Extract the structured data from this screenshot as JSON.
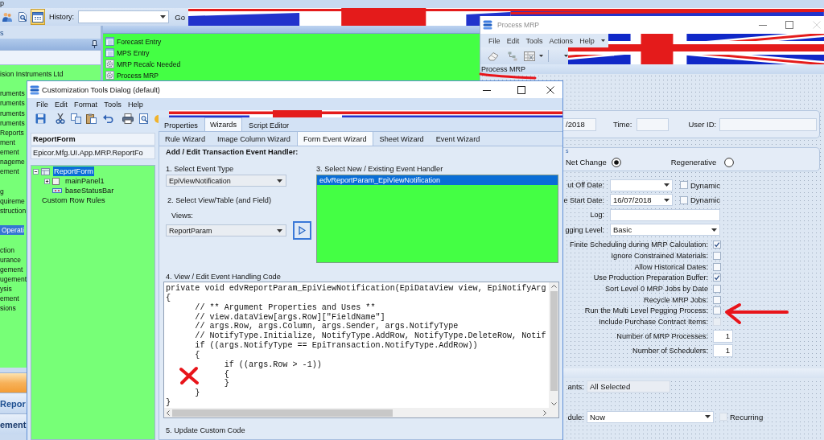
{
  "main_window": {
    "title": "p",
    "toolbar": {
      "buttons": [
        {
          "kind": "people",
          "pressed": false
        },
        {
          "kind": "search",
          "pressed": false
        },
        {
          "kind": "calendar",
          "pressed": true
        }
      ],
      "history_label": "History:",
      "go_label": "Go"
    },
    "nav_panel": {
      "caption": "s",
      "groups": [
        {
          "items": [
            {
              "label": "ision Instruments Ltd",
              "selected": false
            }
          ]
        },
        {
          "items": [
            {
              "label": "ruments",
              "selected": false
            },
            {
              "label": "ruments",
              "selected": false
            },
            {
              "label": "ruments",
              "selected": false
            },
            {
              "label": "ruments",
              "selected": false
            },
            {
              "label": "Reports",
              "selected": false
            },
            {
              "label": "ment",
              "selected": false
            },
            {
              "label": "ement",
              "selected": false
            },
            {
              "label": "nageme",
              "selected": false
            },
            {
              "label": "ement",
              "selected": false
            }
          ]
        },
        {
          "items": [
            {
              "label": "g",
              "selected": false
            },
            {
              "label": "quireme",
              "selected": false
            },
            {
              "label": "struction",
              "selected": false
            }
          ]
        },
        {
          "items": [
            {
              "label": "Operati",
              "selected": true
            }
          ]
        },
        {
          "items": [
            {
              "label": "ction",
              "selected": false
            },
            {
              "label": "urance",
              "selected": false
            },
            {
              "label": "gement",
              "selected": false
            },
            {
              "label": "ugement",
              "selected": false
            },
            {
              "label": "ysis",
              "selected": false
            },
            {
              "label": "ement",
              "selected": false
            },
            {
              "label": "sions",
              "selected": false
            }
          ]
        }
      ],
      "buttons": [
        "Repor",
        "ement"
      ]
    },
    "menu_list": [
      {
        "label": "Forecast Entry",
        "kind": "form"
      },
      {
        "label": "MPS Entry",
        "kind": "form"
      },
      {
        "label": "MRP Recalc Needed",
        "kind": "process"
      },
      {
        "label": "Process MRP",
        "kind": "process"
      }
    ]
  },
  "process_mrp": {
    "title": "Process MRP",
    "menu": [
      "File",
      "Edit",
      "Tools",
      "Actions",
      "Help"
    ],
    "form_title": "Process MRP",
    "run_info": {
      "date_value": "/2018",
      "time_label": "Time:",
      "user_label": "User ID:"
    },
    "run_type": {
      "caption": "s",
      "options": [
        {
          "label": "Net Change",
          "selected": true
        },
        {
          "label": "Regenerative",
          "selected": false
        }
      ]
    },
    "date_rows": [
      {
        "kind": "date",
        "label": "ut Off Date:",
        "dynamic_label": "Dynamic",
        "dynamic_checked": false
      },
      {
        "kind": "date",
        "label": "e Start Date:",
        "value": "16/07/2018",
        "dynamic_label": "Dynamic",
        "dynamic_checked": false
      },
      {
        "kind": "text",
        "label": "Log:"
      },
      {
        "kind": "combo",
        "label": "gging Level:",
        "value": "Basic"
      }
    ],
    "flags": [
      {
        "label": "Finite Scheduling during MRP Calculation:",
        "checked": true,
        "disabled": false
      },
      {
        "label": "Ignore Constrained Materials:",
        "checked": false,
        "disabled": false
      },
      {
        "label": "Allow Historical Dates:",
        "checked": false,
        "disabled": false
      },
      {
        "label": "Use Production Preparation Buffer:",
        "checked": true,
        "disabled": false
      },
      {
        "label": "Sort Level 0 MRP Jobs by Date",
        "checked": false,
        "disabled": false
      },
      {
        "label": "Recycle MRP Jobs:",
        "checked": false,
        "disabled": false
      },
      {
        "label": "Run the Multi Level Pegging Process:",
        "checked": false,
        "disabled": false
      },
      {
        "label": "Include Purchase Contract Items:",
        "checked": false,
        "disabled": true
      }
    ],
    "counts": [
      {
        "label": "Number of MRP Processes:",
        "value": "1"
      },
      {
        "label": "Number of Schedulers:",
        "value": "1"
      }
    ],
    "plants": {
      "label": "ants:",
      "value": "All Selected"
    },
    "schedule": {
      "label": "dule:",
      "value": "Now",
      "recurring_label": "Recurring",
      "recurring_checked": false,
      "recurring_disabled": true
    }
  },
  "customization_dialog": {
    "title": "Customization Tools Dialog (default)",
    "menu": [
      "File",
      "Edit",
      "Format",
      "Tools",
      "Help"
    ],
    "form_name": "ReportForm",
    "class_name": "Epicor.Mfg.UI.App.MRP.ReportFo",
    "tree": [
      {
        "label": "ReportForm",
        "kind": "form",
        "selected": true,
        "expanded": true,
        "children": [
          {
            "label": "mainPanel1",
            "kind": "panel",
            "selected": false,
            "expanded": false
          },
          {
            "label": "baseStatusBar",
            "kind": "statusbar",
            "selected": false
          }
        ]
      },
      {
        "label": "Custom Row Rules",
        "kind": "rules",
        "selected": false
      }
    ],
    "tabs": [
      {
        "label": "Properties",
        "selected": false
      },
      {
        "label": "Wizards",
        "selected": true
      },
      {
        "label": "Script Editor",
        "selected": false
      }
    ],
    "wizard_tabs": [
      {
        "label": "Rule Wizard",
        "selected": false
      },
      {
        "label": "Image Column Wizard",
        "selected": false
      },
      {
        "label": "Form Event Wizard",
        "selected": true
      },
      {
        "label": "Sheet Wizard",
        "selected": false
      },
      {
        "label": "Event Wizard",
        "selected": false
      }
    ],
    "event_wizard": {
      "heading": "Add / Edit Transaction Event Handler:",
      "step1": "1. Select Event Type",
      "event_type": "EpiViewNotification",
      "step2": "2. Select View/Table (and Field)",
      "views_label": "Views:",
      "view": "ReportParam",
      "step3": "3. Select New / Existing Event Handler",
      "handlers": [
        {
          "label": "edvReportParam_EpiViewNotification",
          "selected": true
        }
      ],
      "step4": "4. View / Edit Event Handling Code",
      "code": [
        "private void edvReportParam_EpiViewNotification(EpiDataView view, EpiNotifyArg",
        "{",
        "      // ** Argument Properties and Uses **",
        "      // view.dataView[args.Row][\"FieldName\"]",
        "      // args.Row, args.Column, args.Sender, args.NotifyType",
        "      // NotifyType.Initialize, NotifyType.AddRow, NotifyType.DeleteRow, Notif",
        "      if ((args.NotifyType == EpiTransaction.NotifyType.AddRow))",
        "      {",
        "            if ((args.Row > -1))",
        "            {",
        "            }",
        "      }",
        "}"
      ],
      "step5": "5. Update Custom Code"
    }
  }
}
